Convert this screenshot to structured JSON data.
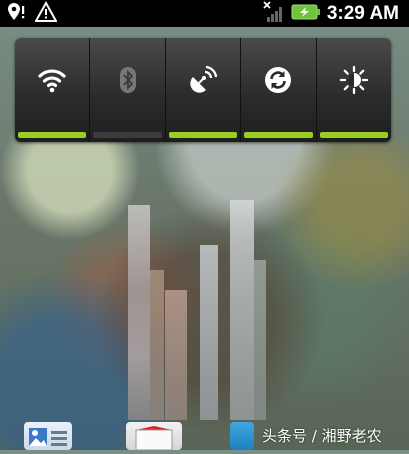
{
  "status_bar": {
    "time": "3:29 AM",
    "left_icons": [
      "location-alert-icon",
      "warning-icon"
    ],
    "right_icons": [
      "no-signal-icon",
      "battery-charging-icon"
    ]
  },
  "quick_toggles": [
    {
      "name": "wifi",
      "icon": "wifi-icon",
      "state": "on"
    },
    {
      "name": "bluetooth",
      "icon": "bluetooth-icon",
      "state": "off"
    },
    {
      "name": "gps",
      "icon": "gps-icon",
      "state": "on"
    },
    {
      "name": "sync",
      "icon": "sync-icon",
      "state": "on"
    },
    {
      "name": "brightness",
      "icon": "brightness-icon",
      "state": "on"
    }
  ],
  "dock": {
    "icons": [
      "gallery-icon",
      "mail-icon",
      "phone-icon"
    ]
  },
  "watermark": "头条号 / 湘野老农",
  "colors": {
    "toggle_on": "#9acd25",
    "toggle_off": "#3c3c3c",
    "statusbar_bg": "#000000",
    "battery": "#6fc23c"
  }
}
